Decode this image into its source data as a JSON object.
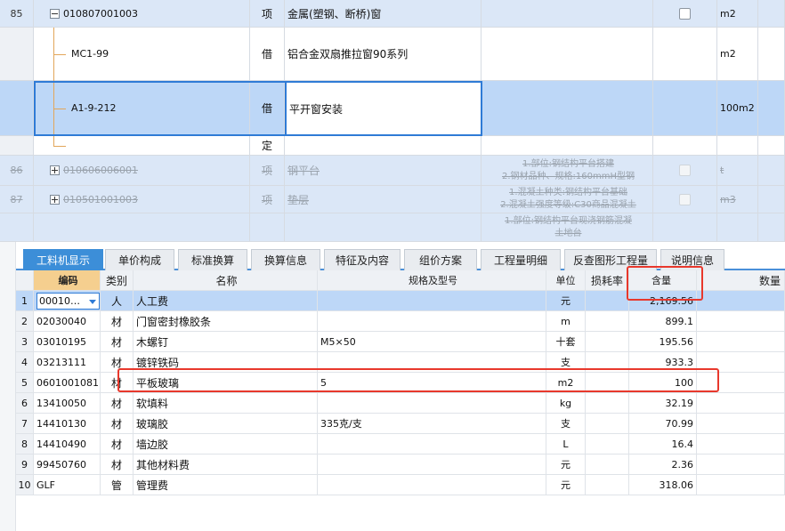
{
  "upper_rows": [
    {
      "row_num": "85",
      "code": "010807001003",
      "type": "项",
      "name": "金属(塑钢、断桥)窗",
      "spec": [],
      "unit": "m2",
      "style": "blue",
      "expander": "minus",
      "checkbox": "normal"
    },
    {
      "row_num": "",
      "code": "MC1-99",
      "type": "借",
      "name": "铝合金双扇推拉窗90系列",
      "spec": [],
      "unit": "m2",
      "style": "white"
    },
    {
      "row_num": "",
      "code": "A1-9-212",
      "type": "借",
      "name": "平开窗安装",
      "spec": [],
      "unit": "100m2",
      "style": "selected"
    },
    {
      "row_num": "",
      "code": "",
      "type": "定",
      "name": "",
      "spec": [],
      "unit": "",
      "style": "white"
    },
    {
      "row_num": "86",
      "code": "010606006001",
      "type": "项",
      "name": "钢平台",
      "spec": [
        "1.部位:钢结构平台搭建",
        "2.钢材品种、规格:160mmH型钢"
      ],
      "unit": "t",
      "style": "blue",
      "expander": "plus",
      "checkbox": "dim",
      "strike": true
    },
    {
      "row_num": "87",
      "code": "010501001003",
      "type": "项",
      "name": "垫层",
      "spec": [
        "1.混凝土种类:钢结构平台基础",
        "2.混凝土强度等级:C30商品混凝土"
      ],
      "unit": "m3",
      "style": "blue",
      "expander": "plus",
      "checkbox": "dim",
      "strike": true
    },
    {
      "row_num": "",
      "code": "",
      "type": "",
      "name": "",
      "spec": [
        "1.部位:钢结构平台现浇钢筋混凝",
        "土地台"
      ],
      "unit": "",
      "style": "blue",
      "strike": true
    }
  ],
  "tabs": [
    "工料机显示",
    "单价构成",
    "标准换算",
    "换算信息",
    "特征及内容",
    "组价方案",
    "工程量明细",
    "反查图形工程量",
    "说明信息"
  ],
  "active_tab": "工料机显示",
  "lower_headers": {
    "code": "编码",
    "category": "类别",
    "name": "名称",
    "spec": "规格及型号",
    "unit": "单位",
    "loss": "损耗率",
    "quantity": "含量",
    "count": "数量"
  },
  "lower_rows": [
    {
      "num": "1",
      "code": "00010…",
      "category": "人",
      "name": "人工费",
      "spec": "",
      "unit": "元",
      "loss": "",
      "quantity": "2,169.56",
      "count": ""
    },
    {
      "num": "2",
      "code": "02030040",
      "category": "材",
      "name": "门窗密封橡胶条",
      "spec": "",
      "unit": "m",
      "loss": "",
      "quantity": "899.1",
      "count": ""
    },
    {
      "num": "3",
      "code": "03010195",
      "category": "材",
      "name": "木螺钉",
      "spec": "M5×50",
      "unit": "十套",
      "loss": "",
      "quantity": "195.56",
      "count": ""
    },
    {
      "num": "4",
      "code": "03213111",
      "category": "材",
      "name": "镀锌铁码",
      "spec": "",
      "unit": "支",
      "loss": "",
      "quantity": "933.3",
      "count": ""
    },
    {
      "num": "5",
      "code": "0601001081",
      "category": "材",
      "name": "平板玻璃",
      "spec": "5",
      "unit": "m2",
      "loss": "",
      "quantity": "100",
      "count": ""
    },
    {
      "num": "6",
      "code": "13410050",
      "category": "材",
      "name": "软填料",
      "spec": "",
      "unit": "kg",
      "loss": "",
      "quantity": "32.19",
      "count": ""
    },
    {
      "num": "7",
      "code": "14410130",
      "category": "材",
      "name": "玻璃胶",
      "spec": "335克/支",
      "unit": "支",
      "loss": "",
      "quantity": "70.99",
      "count": ""
    },
    {
      "num": "8",
      "code": "14410490",
      "category": "材",
      "name": "墙边胶",
      "spec": "",
      "unit": "L",
      "loss": "",
      "quantity": "16.4",
      "count": ""
    },
    {
      "num": "9",
      "code": "99450760",
      "category": "材",
      "name": "其他材料费",
      "spec": "",
      "unit": "元",
      "loss": "",
      "quantity": "2.36",
      "count": ""
    },
    {
      "num": "10",
      "code": "GLF",
      "category": "管",
      "name": "管理费",
      "spec": "",
      "unit": "元",
      "loss": "",
      "quantity": "318.06",
      "count": ""
    }
  ],
  "colors": {
    "tab_active": "#3c8ed8",
    "selection": "#bdd7f7",
    "row_blue": "#dbe7f7",
    "highlight_box": "#e8382c",
    "code_header": "#f5cf8f"
  }
}
